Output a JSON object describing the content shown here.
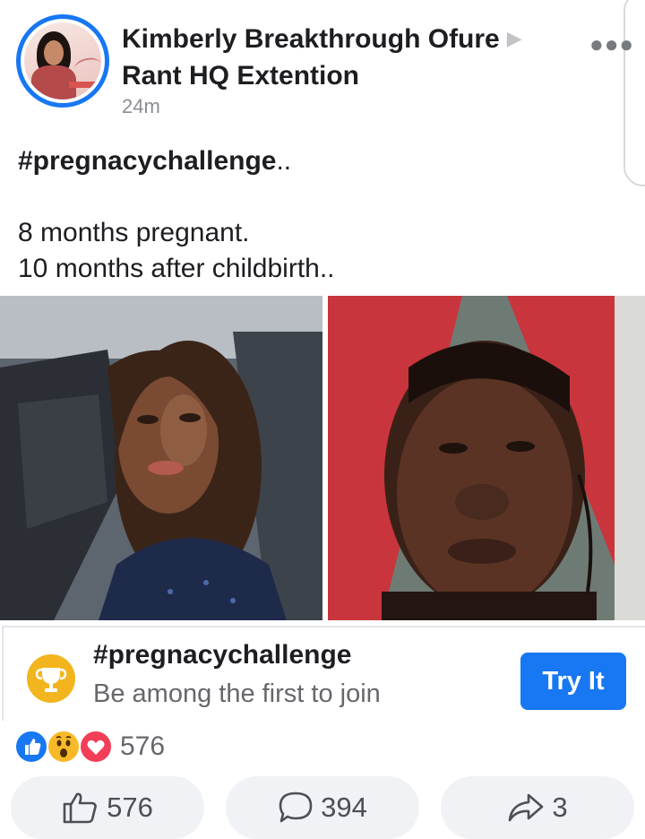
{
  "post": {
    "author": "Kimberly Breakthrough Ofure",
    "group": "Rant HQ Extention",
    "arrow_icon": "triangle-right",
    "time": "24m",
    "more_icon": "ellipsis-icon",
    "text": {
      "hashtag": "#pregnacychallenge",
      "hashtag_suffix": "..",
      "line1": "8 months pregnant.",
      "line2": "10 months after childbirth.."
    }
  },
  "challenge": {
    "title": "#pregnacychallenge",
    "subtitle": "Be among the first to join",
    "button": "Try It",
    "icon": "trophy-icon",
    "accent": "#1877f2",
    "icon_color": "#f2b51e"
  },
  "reactions": {
    "icons": [
      "like",
      "wow",
      "love"
    ],
    "count": "576"
  },
  "actions": {
    "like_count": "576",
    "comment_count": "394",
    "share_count": "3"
  }
}
